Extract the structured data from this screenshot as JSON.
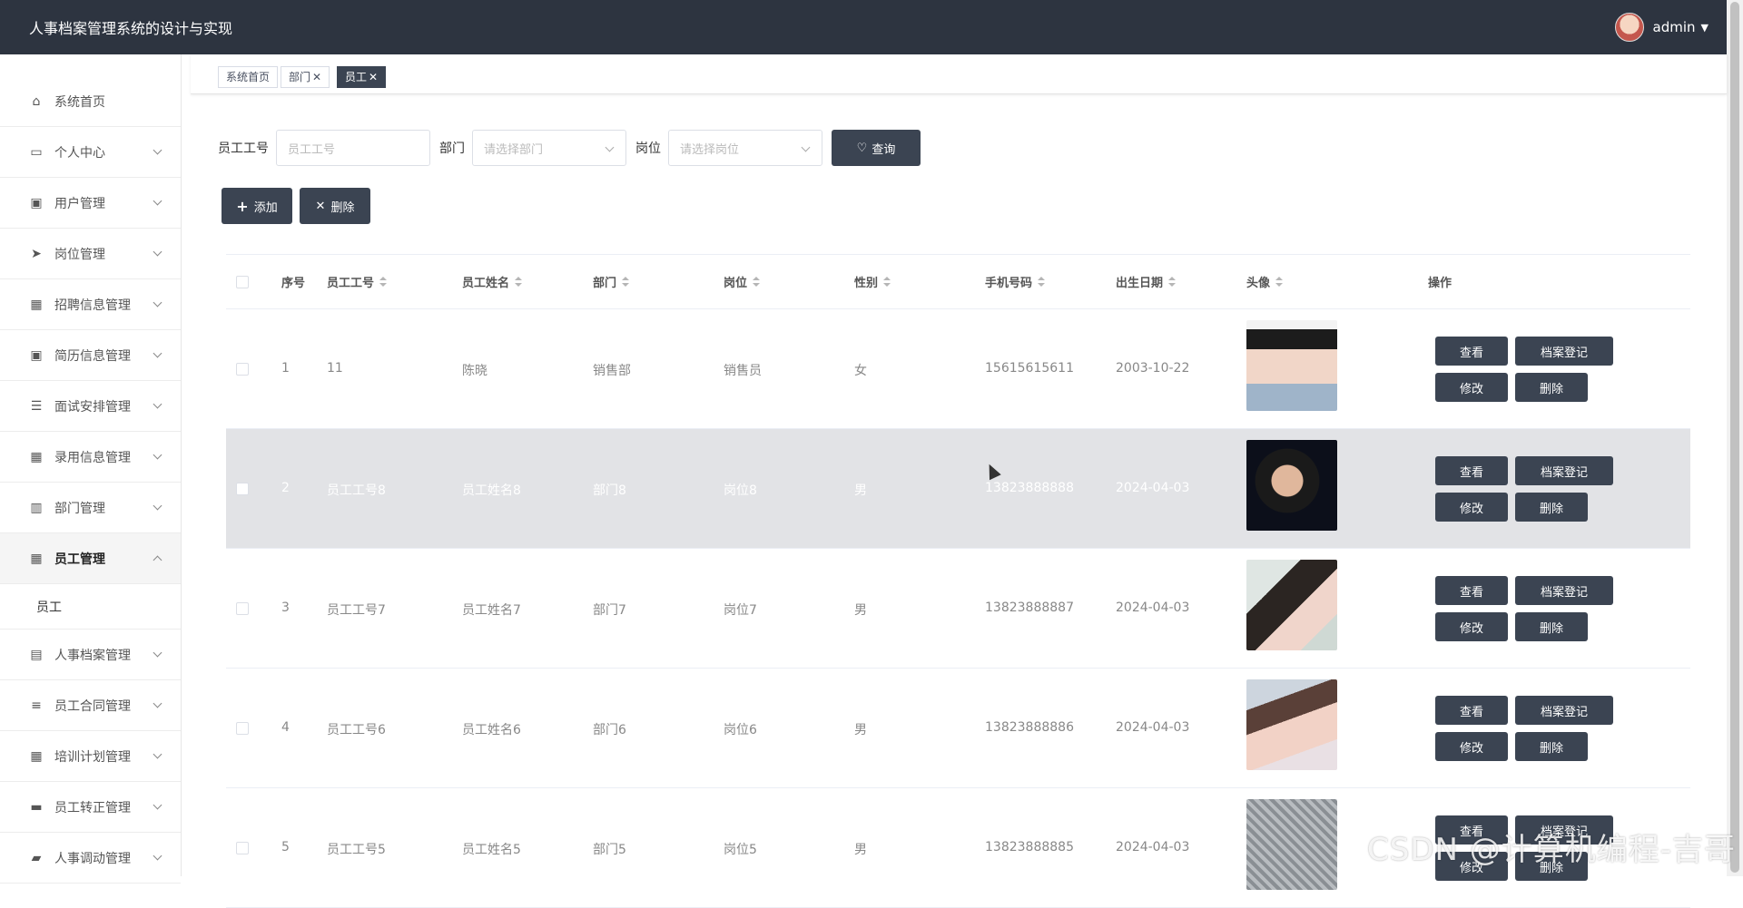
{
  "header": {
    "title": "人事档案管理系统的设计与实现",
    "user": "admin"
  },
  "sidebar": {
    "items": [
      {
        "label": "系统首页",
        "icon": "home-icon"
      },
      {
        "label": "个人中心",
        "icon": "card-icon"
      },
      {
        "label": "用户管理",
        "icon": "clipboard-icon"
      },
      {
        "label": "岗位管理",
        "icon": "send-icon"
      },
      {
        "label": "招聘信息管理",
        "icon": "grid-icon"
      },
      {
        "label": "简历信息管理",
        "icon": "clipboard-icon"
      },
      {
        "label": "面试安排管理",
        "icon": "list-icon"
      },
      {
        "label": "录用信息管理",
        "icon": "grid-icon"
      },
      {
        "label": "部门管理",
        "icon": "building-icon"
      },
      {
        "label": "员工管理",
        "icon": "apps-icon"
      },
      {
        "label": "人事档案管理",
        "icon": "briefcase-icon"
      },
      {
        "label": "员工合同管理",
        "icon": "sliders-icon"
      },
      {
        "label": "培训计划管理",
        "icon": "grid-icon"
      },
      {
        "label": "员工转正管理",
        "icon": "chat-icon"
      },
      {
        "label": "人事调动管理",
        "icon": "truck-icon"
      }
    ],
    "submenu": "员工"
  },
  "tags": [
    "系统首页",
    "部门",
    "员工"
  ],
  "search": {
    "emp_no_label": "员工工号",
    "emp_no_placeholder": "员工工号",
    "dept_label": "部门",
    "dept_placeholder": "请选择部门",
    "post_label": "岗位",
    "post_placeholder": "请选择岗位",
    "query_label": "查询"
  },
  "actions": {
    "add": "添加",
    "delete": "删除"
  },
  "table": {
    "headers": [
      "序号",
      "员工工号",
      "员工姓名",
      "部门",
      "岗位",
      "性别",
      "手机号码",
      "出生日期",
      "头像",
      "操作"
    ],
    "ops": [
      "查看",
      "档案登记",
      "修改",
      "删除"
    ],
    "rows": [
      {
        "idx": "1",
        "no": "11",
        "name": "陈晓",
        "dept": "销售部",
        "post": "销售员",
        "sex": "女",
        "phone": "15615615611",
        "birth": "2003-10-22"
      },
      {
        "idx": "2",
        "no": "员工工号8",
        "name": "员工姓名8",
        "dept": "部门8",
        "post": "岗位8",
        "sex": "男",
        "phone": "13823888888",
        "birth": "2024-04-03"
      },
      {
        "idx": "3",
        "no": "员工工号7",
        "name": "员工姓名7",
        "dept": "部门7",
        "post": "岗位7",
        "sex": "男",
        "phone": "13823888887",
        "birth": "2024-04-03"
      },
      {
        "idx": "4",
        "no": "员工工号6",
        "name": "员工姓名6",
        "dept": "部门6",
        "post": "岗位6",
        "sex": "男",
        "phone": "13823888886",
        "birth": "2024-04-03"
      },
      {
        "idx": "5",
        "no": "员工工号5",
        "name": "员工姓名5",
        "dept": "部门5",
        "post": "岗位5",
        "sex": "男",
        "phone": "13823888885",
        "birth": "2024-04-03"
      }
    ]
  },
  "watermark": "CSDN @计算机编程-吉哥",
  "colors": {
    "header_bg": "#2d3440",
    "button_bg": "#3b4452",
    "highlight_row": "#e2e3e6"
  }
}
